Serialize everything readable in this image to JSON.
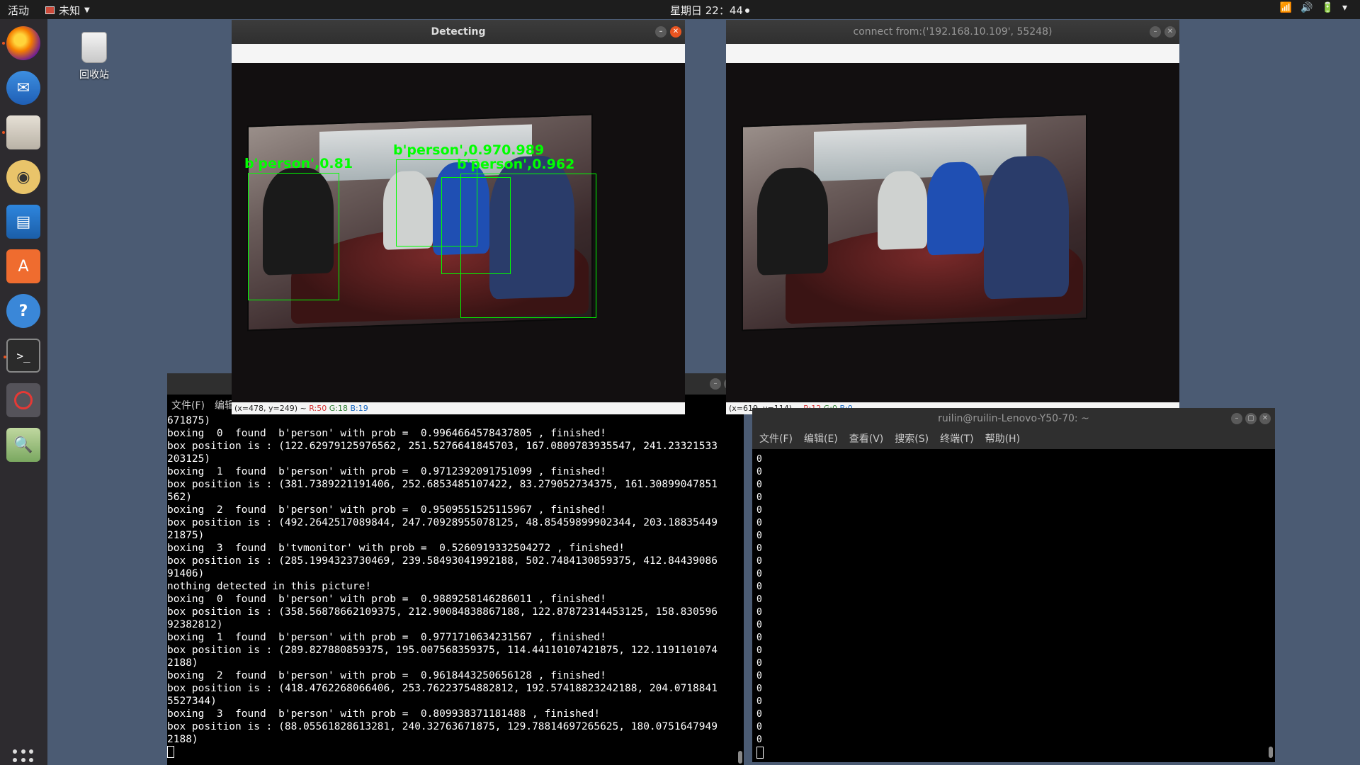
{
  "topbar": {
    "activities": "活动",
    "app_menu": "未知",
    "clock": "星期日 22：44"
  },
  "desktop": {
    "trash_label": "回收站"
  },
  "dock": {
    "items": [
      {
        "name": "firefox"
      },
      {
        "name": "thunderbird"
      },
      {
        "name": "files"
      },
      {
        "name": "rhythmbox"
      },
      {
        "name": "libreoffice-writer"
      },
      {
        "name": "ubuntu-software"
      },
      {
        "name": "help"
      },
      {
        "name": "terminal"
      },
      {
        "name": "blocked-app"
      },
      {
        "name": "image-viewer"
      }
    ]
  },
  "detect_window": {
    "title": "Detecting",
    "status": {
      "coords": "(x=478, y=249) ~ ",
      "r": "R:50",
      "g": "G:18",
      "b": "B:19"
    },
    "labels": [
      "b'person',0.81",
      "b'person',0.970.989",
      "b'person',0.962"
    ]
  },
  "remote_window": {
    "title": "connect from:('192.168.10.109', 55248)",
    "status": {
      "coords": "(x=619, y=114) ~ ",
      "r": "R:12",
      "g": "G:0",
      "b": "B:0"
    }
  },
  "terminal_left": {
    "menu": [
      "文件(F)",
      "编辑"
    ],
    "lines": [
      "671875)",
      "boxing  0  found  b'person' with prob =  0.9964664578437805 , finished!",
      "box position is : (122.62979125976562, 251.5276641845703, 167.0809783935547, 241.23321533",
      "203125)",
      "boxing  1  found  b'person' with prob =  0.9712392091751099 , finished!",
      "box position is : (381.7389221191406, 252.6853485107422, 83.279052734375, 161.30899047851",
      "562)",
      "boxing  2  found  b'person' with prob =  0.9509551525115967 , finished!",
      "box position is : (492.2642517089844, 247.70928955078125, 48.85459899902344, 203.18835449",
      "21875)",
      "boxing  3  found  b'tvmonitor' with prob =  0.5260919332504272 , finished!",
      "box position is : (285.1994323730469, 239.58493041992188, 502.7484130859375, 412.84439086",
      "91406)",
      "nothing detected in this picture!",
      "boxing  0  found  b'person' with prob =  0.9889258146286011 , finished!",
      "box position is : (358.56878662109375, 212.90084838867188, 122.87872314453125, 158.830596",
      "92382812)",
      "boxing  1  found  b'person' with prob =  0.9771710634231567 , finished!",
      "box position is : (289.827880859375, 195.007568359375, 114.44110107421875, 122.1191101074",
      "2188)",
      "boxing  2  found  b'person' with prob =  0.9618443250656128 , finished!",
      "box position is : (418.4762268066406, 253.76223754882812, 192.57418823242188, 204.0718841",
      "5527344)",
      "boxing  3  found  b'person' with prob =  0.809938371181488 , finished!",
      "box position is : (88.05561828613281, 240.32763671875, 129.78814697265625, 180.0751647949",
      "2188)"
    ]
  },
  "terminal_right": {
    "title": "ruilin@ruilin-Lenovo-Y50-70: ~",
    "menu": [
      "文件(F)",
      "编辑(E)",
      "查看(V)",
      "搜索(S)",
      "终端(T)",
      "帮助(H)"
    ],
    "zeros": [
      "0",
      "0",
      "0",
      "0",
      "0",
      "0",
      "0",
      "0",
      "0",
      "0",
      "0",
      "0",
      "0",
      "0",
      "0",
      "0",
      "0",
      "0",
      "0",
      "0",
      "0",
      "0",
      "0"
    ]
  }
}
